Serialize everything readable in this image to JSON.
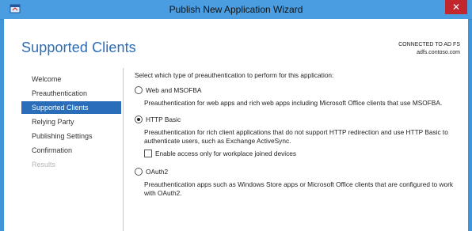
{
  "window": {
    "title": "Publish New Application Wizard",
    "close_symbol": "✕",
    "icon": "wizard-app-icon",
    "accent": "#3f95da",
    "close_color": "#c1272d"
  },
  "header": {
    "page_title": "Supported Clients",
    "connection_line1": "CONNECTED TO AD FS",
    "connection_line2": "adfs.contoso.com"
  },
  "nav": {
    "items": [
      {
        "label": "Welcome",
        "state": "normal"
      },
      {
        "label": "Preauthentication",
        "state": "normal"
      },
      {
        "label": "Supported Clients",
        "state": "active"
      },
      {
        "label": "Relying Party",
        "state": "normal"
      },
      {
        "label": "Publishing Settings",
        "state": "normal"
      },
      {
        "label": "Confirmation",
        "state": "normal"
      },
      {
        "label": "Results",
        "state": "disabled"
      }
    ]
  },
  "main": {
    "prompt": "Select which type of preauthentication to perform for this application:",
    "options": [
      {
        "label": "Web and MSOFBA",
        "selected": false,
        "description": "Preauthentication for web apps and rich web apps including Microsoft Office clients that use MSOFBA."
      },
      {
        "label": "HTTP Basic",
        "selected": true,
        "description": "Preauthentication for rich client applications that do not support HTTP redirection and use HTTP Basic to authenticate users, such as Exchange ActiveSync.",
        "checkbox_label": "Enable access only for workplace joined devices",
        "checkbox_checked": false
      },
      {
        "label": "OAuth2",
        "selected": false,
        "description": "Preauthentication apps such as Windows Store apps or Microsoft Office clients that are configured to work with OAuth2."
      }
    ]
  }
}
